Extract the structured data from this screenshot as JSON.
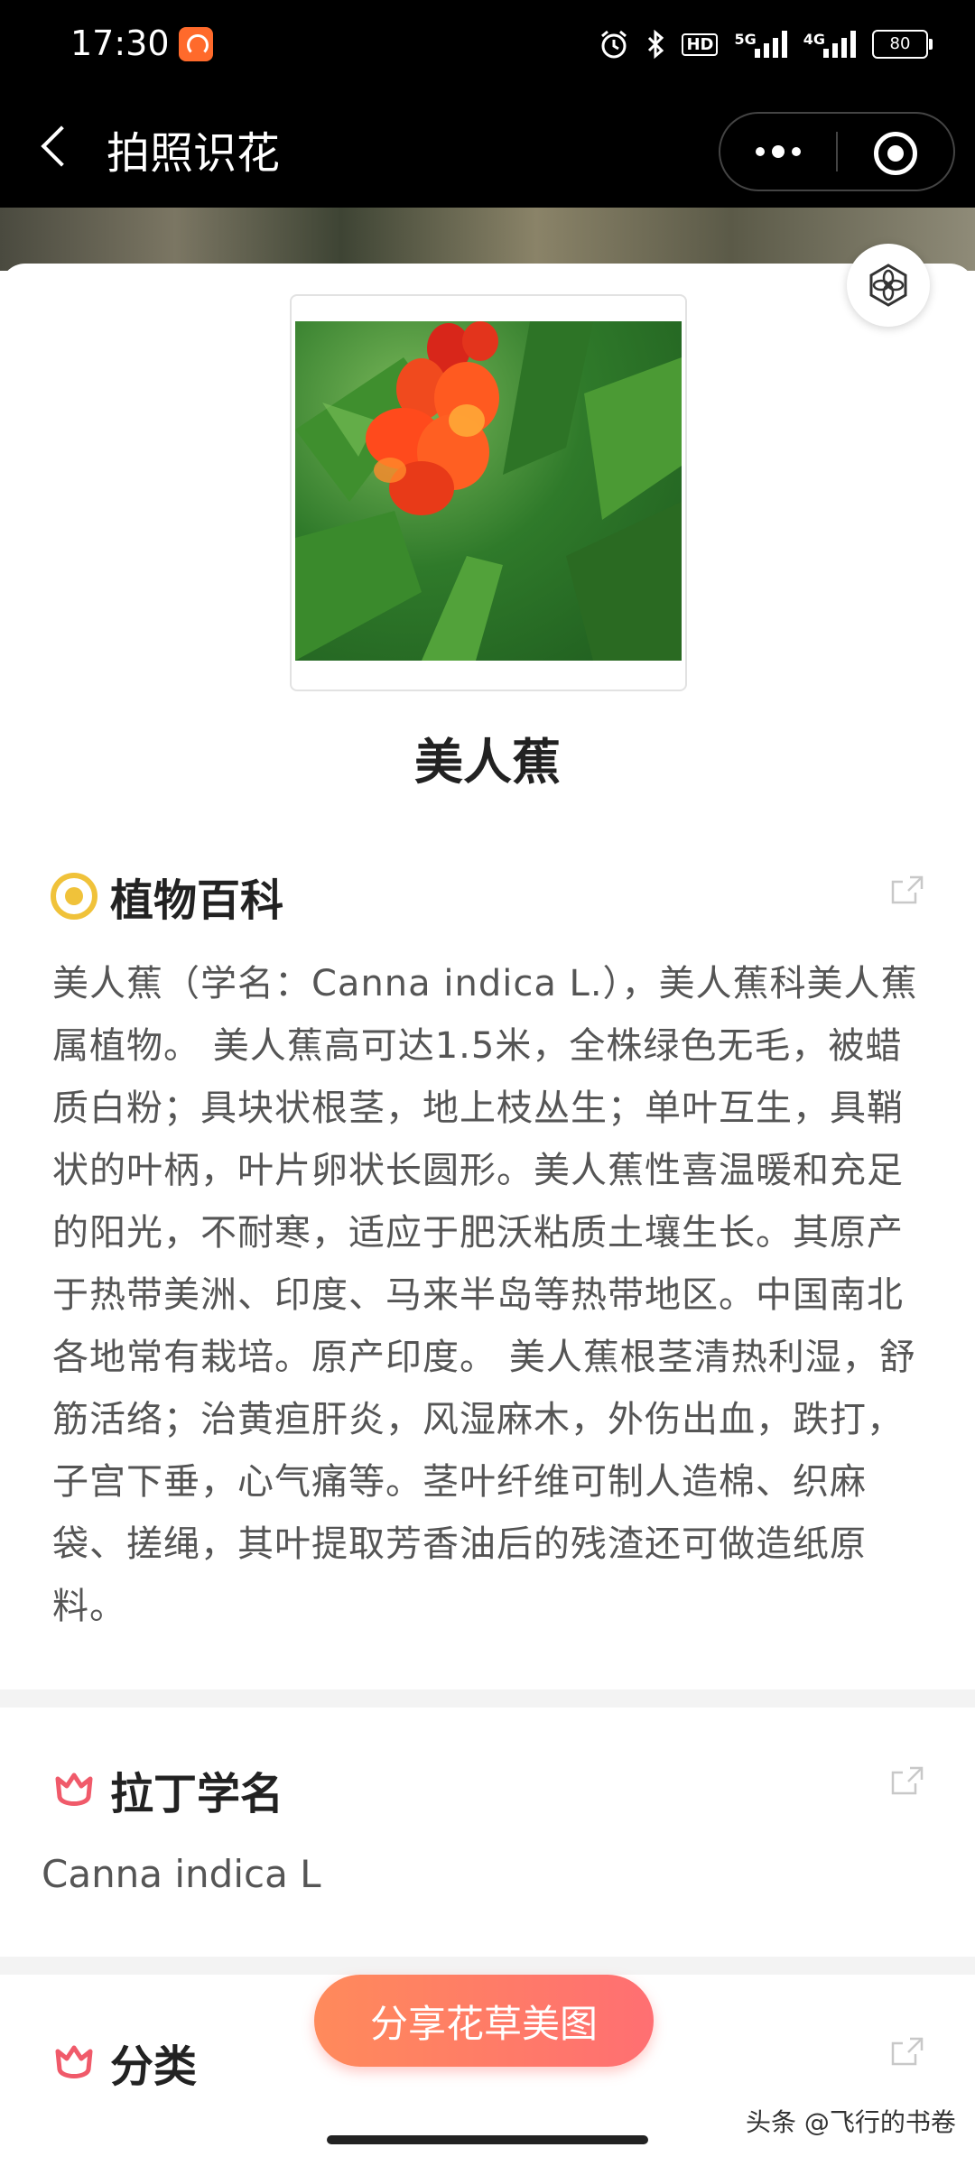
{
  "status_bar": {
    "time": "17:30",
    "network": "5G",
    "network2": "4G",
    "hd": "HD",
    "battery": "80",
    "icons": [
      "app-notification-icon",
      "alarm-icon",
      "bluetooth-icon",
      "hd-icon",
      "signal-5g-icon",
      "signal-4g-icon",
      "battery-icon"
    ]
  },
  "nav": {
    "title": "拍照识花"
  },
  "result": {
    "plant_name": "美人蕉"
  },
  "sections": {
    "encyclopedia": {
      "title": "植物百科",
      "text": "美人蕉（学名：Canna indica L.），美人蕉科美人蕉属植物。 美人蕉高可达1.5米，全株绿色无毛，被蜡质白粉；具块状根茎，地上枝丛生；单叶互生，具鞘状的叶柄，叶片卵状长圆形。美人蕉性喜温暖和充足的阳光，不耐寒，适应于肥沃粘质土壤生长。其原产于热带美洲、印度、马来半岛等热带地区。中国南北各地常有栽培。原产印度。 美人蕉根茎清热利湿，舒筋活络；治黄疸肝炎，风湿麻木，外伤出血，跌打，子宫下垂，心气痛等。茎叶纤维可制人造棉、织麻袋、搓绳，其叶提取芳香油后的残渣还可做造纸原料。"
    },
    "latin": {
      "title": "拉丁学名",
      "value": "Canna indica L"
    },
    "classification": {
      "title": "分类"
    }
  },
  "share_button": {
    "label": "分享花草美图"
  },
  "watermark": "头条 @飞行的书卷",
  "colors": {
    "accent_gradient_start": "#ff8a5b",
    "accent_gradient_end": "#ff6f72",
    "eye_icon": "#f0c23a",
    "tulip_icon": "#f05a6a"
  }
}
